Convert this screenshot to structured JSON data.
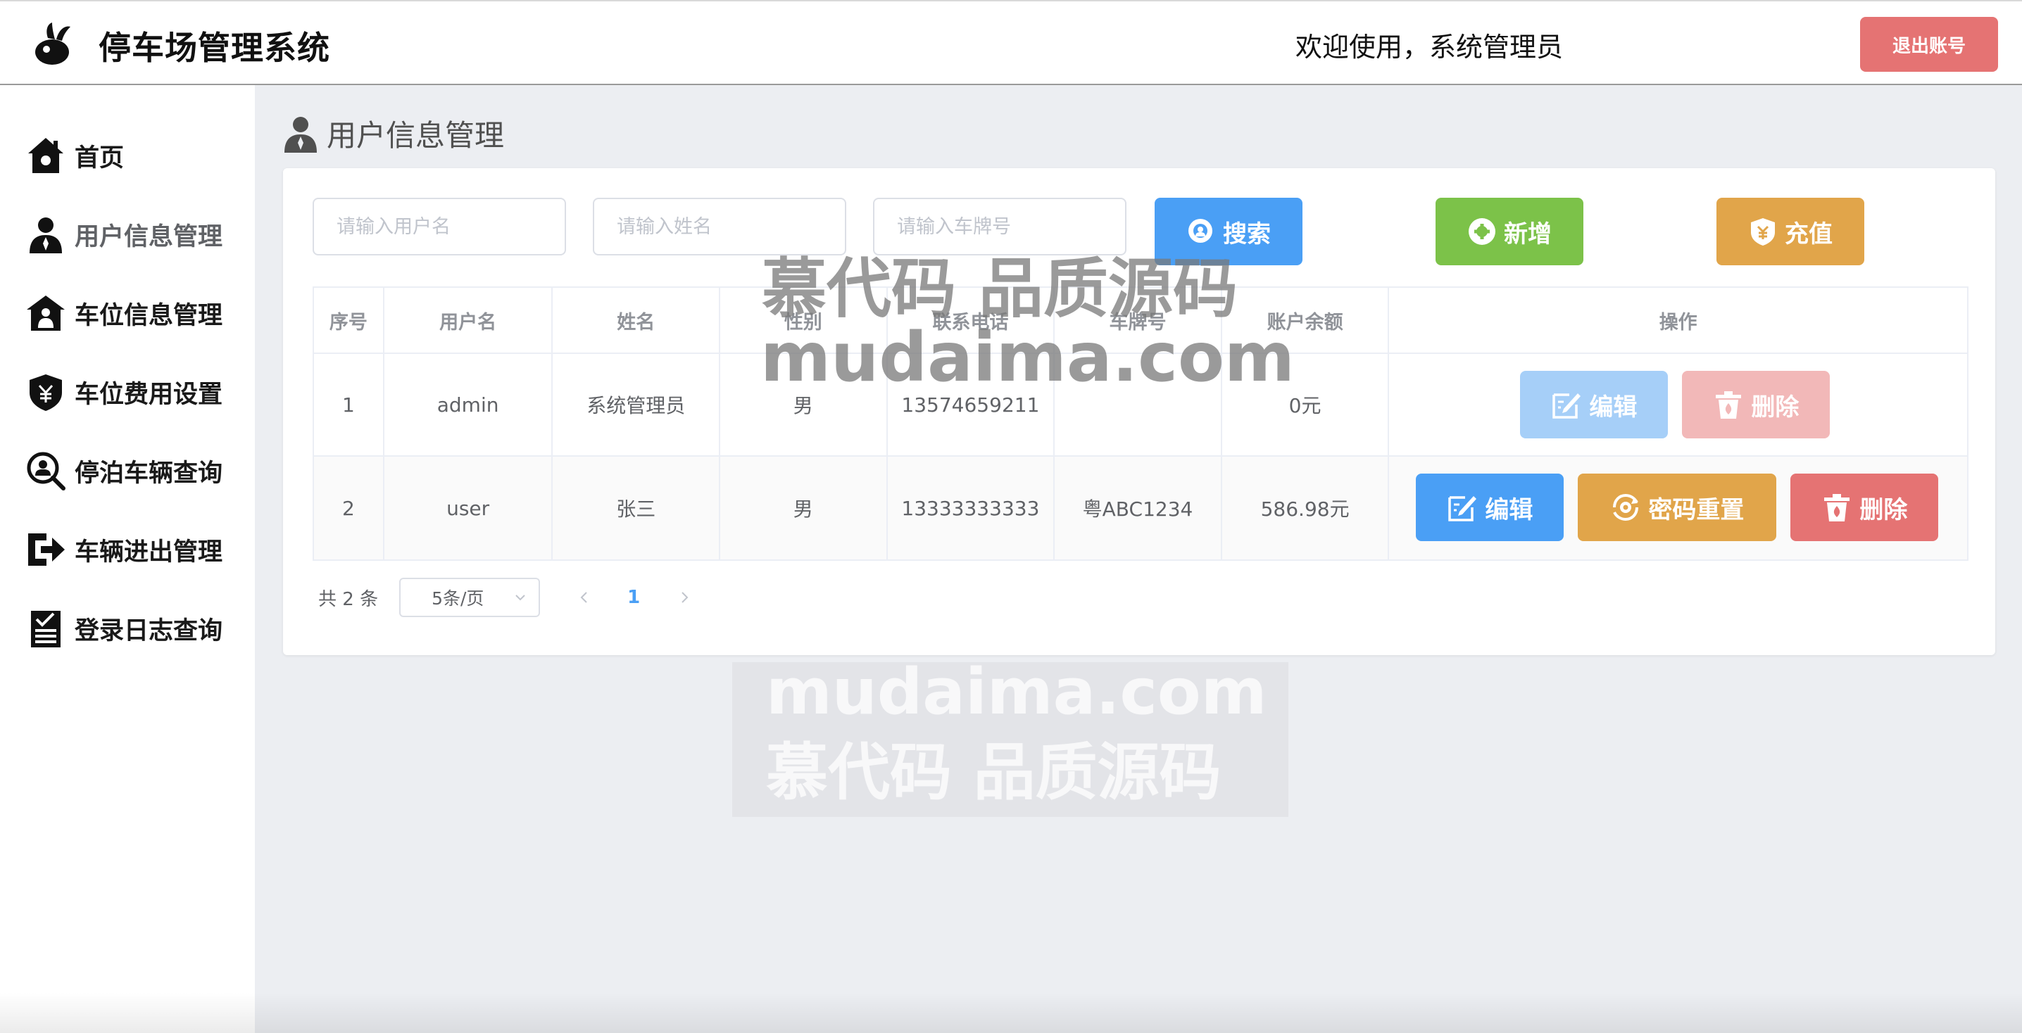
{
  "header": {
    "app_title": "停车场管理系统",
    "welcome": "欢迎使用，系统管理员",
    "logout_label": "退出账号"
  },
  "sidebar": {
    "items": [
      {
        "label": "首页",
        "icon": "home-icon"
      },
      {
        "label": "用户信息管理",
        "icon": "user-icon",
        "active": true
      },
      {
        "label": "车位信息管理",
        "icon": "parking-icon"
      },
      {
        "label": "车位费用设置",
        "icon": "shield-yen-icon"
      },
      {
        "label": "停泊车辆查询",
        "icon": "search-user-icon"
      },
      {
        "label": "车辆进出管理",
        "icon": "arrow-right-icon"
      },
      {
        "label": "登录日志查询",
        "icon": "log-icon"
      }
    ]
  },
  "page": {
    "title": "用户信息管理"
  },
  "search": {
    "username_placeholder": "请输入用户名",
    "name_placeholder": "请输入姓名",
    "plate_placeholder": "请输入车牌号",
    "search_label": "搜索",
    "add_label": "新增",
    "recharge_label": "充值"
  },
  "table": {
    "headers": [
      "序号",
      "用户名",
      "姓名",
      "性别",
      "联系电话",
      "车牌号",
      "账户余额",
      "操作"
    ],
    "rows": [
      {
        "index": "1",
        "username": "admin",
        "name": "系统管理员",
        "gender": "男",
        "phone": "13574659211",
        "plate": "",
        "balance": "0元"
      },
      {
        "index": "2",
        "username": "user",
        "name": "张三",
        "gender": "男",
        "phone": "13333333333",
        "plate": "粤ABC1234",
        "balance": "586.98元"
      }
    ],
    "edit_label": "编辑",
    "delete_label": "删除",
    "reset_password_label": "密码重置"
  },
  "pagination": {
    "total": "共 2 条",
    "page_size": "5条/页",
    "current_page": "1"
  },
  "watermark": {
    "line1": "慕代码 品质源码",
    "line2": "mudaima.com"
  },
  "colors": {
    "primary": "#4a9ff5",
    "success": "#7cc249",
    "warning": "#e1a54a",
    "danger": "#e57373",
    "background": "#eceef2"
  }
}
